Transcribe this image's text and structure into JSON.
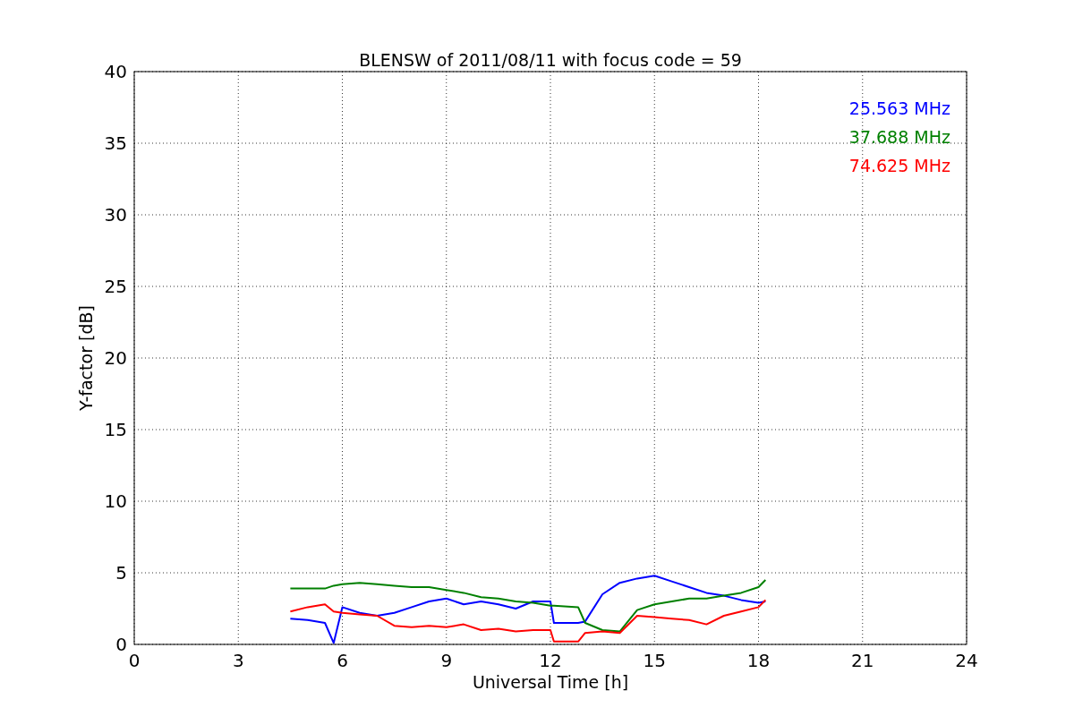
{
  "chart_data": {
    "type": "line",
    "title": "BLENSW of 2011/08/11 with focus code = 59",
    "xlabel": "Universal Time [h]",
    "ylabel": "Y-factor [dB]",
    "x": [
      4.5,
      5,
      5.5,
      5.75,
      6,
      6.5,
      7,
      7.5,
      8,
      8.5,
      9,
      9.5,
      10,
      10.5,
      11,
      11.5,
      12,
      12.1,
      12.8,
      13,
      13.5,
      14,
      14.5,
      15,
      15.5,
      16,
      16.5,
      17,
      17.5,
      18,
      18.2
    ],
    "series": [
      {
        "name": "25.563 MHz",
        "color": "#0000ff",
        "values": [
          1.8,
          1.7,
          1.5,
          0.1,
          2.6,
          2.2,
          2.0,
          2.2,
          2.6,
          3.0,
          3.2,
          2.8,
          3.0,
          2.8,
          2.5,
          3.0,
          3.0,
          1.5,
          1.5,
          1.6,
          3.5,
          4.3,
          4.6,
          4.8,
          4.4,
          4.0,
          3.6,
          3.4,
          3.1,
          2.9,
          3.0
        ]
      },
      {
        "name": "37.688 MHz",
        "color": "#008000",
        "values": [
          3.9,
          3.9,
          3.9,
          4.1,
          4.2,
          4.3,
          4.2,
          4.1,
          4.0,
          4.0,
          3.8,
          3.6,
          3.3,
          3.2,
          3.0,
          2.9,
          2.7,
          2.7,
          2.6,
          1.5,
          1.0,
          0.9,
          2.4,
          2.8,
          3.0,
          3.2,
          3.2,
          3.4,
          3.6,
          4.0,
          4.5
        ]
      },
      {
        "name": "74.625 MHz",
        "color": "#ff0000",
        "values": [
          2.3,
          2.6,
          2.8,
          2.3,
          2.2,
          2.1,
          2.0,
          1.3,
          1.2,
          1.3,
          1.2,
          1.4,
          1.0,
          1.1,
          0.9,
          1.0,
          1.0,
          0.2,
          0.2,
          0.8,
          0.9,
          0.8,
          2.0,
          1.9,
          1.8,
          1.7,
          1.4,
          2.0,
          2.3,
          2.6,
          3.1
        ]
      }
    ],
    "grid": true,
    "xlim": [
      0,
      24
    ],
    "ylim": [
      0,
      40
    ],
    "xticks": [
      0,
      3,
      6,
      9,
      12,
      15,
      18,
      21,
      24
    ],
    "yticks": [
      0,
      5,
      10,
      15,
      20,
      25,
      30,
      35,
      40
    ]
  }
}
